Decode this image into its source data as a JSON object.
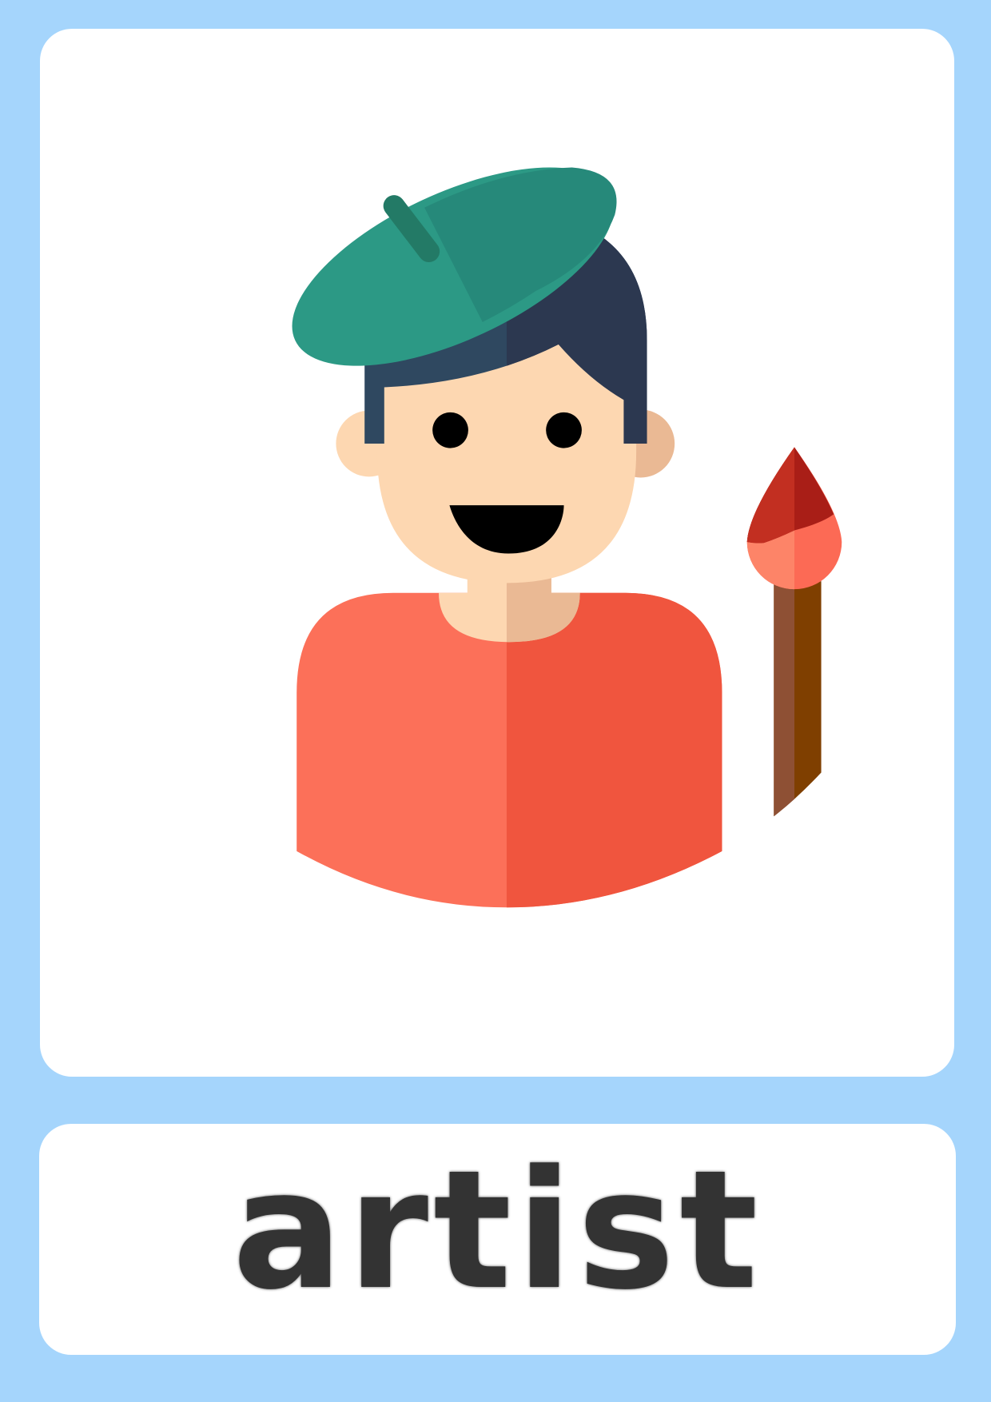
{
  "card": {
    "word": "artist",
    "illustration": "artist-with-beret-and-paintbrush",
    "colors": {
      "background": "#a5d5fc",
      "panel": "#ffffff",
      "text": "#333333",
      "shirt_light": "#fc7059",
      "shirt_dark": "#f0553e",
      "skin_light": "#fdd7b1",
      "skin_dark": "#eab994",
      "hair": "#2c3850",
      "beret_light": "#2c9985",
      "beret_dark": "#26897a",
      "brush_handle_light": "#8e5034",
      "brush_handle_dark": "#7f3f00",
      "brush_tip_dark": "#c22f21"
    }
  }
}
